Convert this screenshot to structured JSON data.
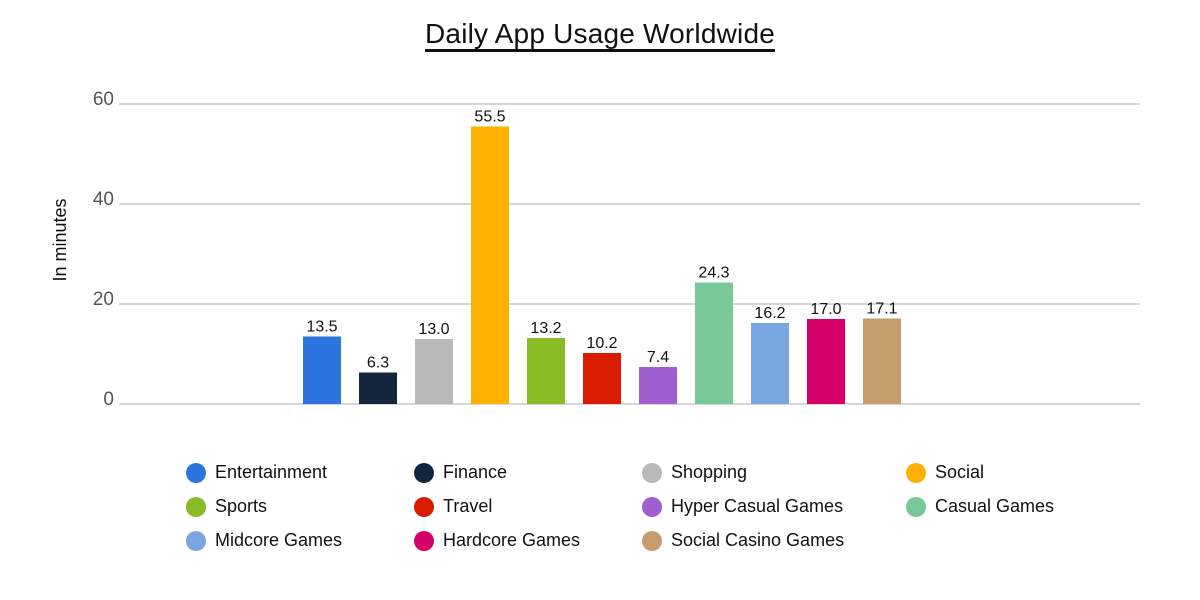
{
  "chart_data": {
    "type": "bar",
    "title": "Daily App Usage Worldwide",
    "xlabel": "",
    "ylabel": "In minutes",
    "ylim": [
      0,
      60
    ],
    "yticks": [
      0,
      20,
      40,
      60
    ],
    "grid": true,
    "legend_position": "bottom",
    "categories": [
      "Entertainment",
      "Finance",
      "Shopping",
      "Social",
      "Sports",
      "Travel",
      "Hyper Casual Games",
      "Casual Games",
      "Midcore Games",
      "Hardcore Games",
      "Social Casino Games"
    ],
    "values": [
      13.5,
      6.3,
      13.0,
      55.5,
      13.2,
      10.2,
      7.4,
      24.3,
      16.2,
      17.0,
      17.1
    ],
    "data_labels": [
      "13.5",
      "6.3",
      "13.0",
      "55.5",
      "13.2",
      "10.2",
      "7.4",
      "24.3",
      "16.2",
      "17.0",
      "17.1"
    ],
    "colors": [
      "#2b76de",
      "#14263e",
      "#b9b9b9",
      "#fdb000",
      "#88bb25",
      "#d91c00",
      "#a05fce",
      "#79c898",
      "#79a5e2",
      "#d6006a",
      "#c69c6c"
    ]
  }
}
